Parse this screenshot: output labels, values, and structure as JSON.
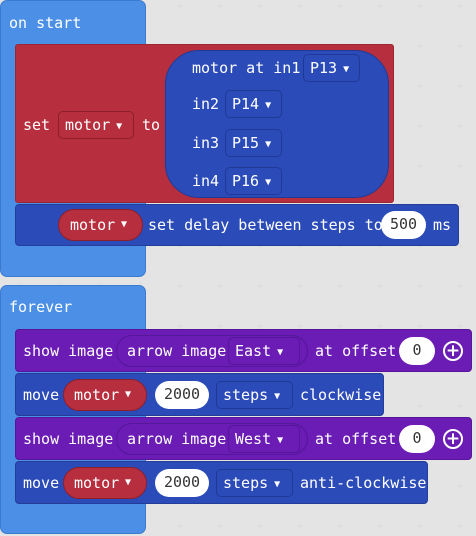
{
  "on_start": {
    "label": "on start",
    "set_block": {
      "set_label": "set",
      "variable": "motor",
      "to_label": "to",
      "motor_at": {
        "label": "motor at in1",
        "in1_pin": "P13",
        "in2_label": "in2",
        "in2_pin": "P14",
        "in3_label": "in3",
        "in3_pin": "P15",
        "in4_label": "in4",
        "in4_pin": "P16"
      }
    },
    "delay_block": {
      "variable": "motor",
      "label": "set delay between steps to",
      "value": "500",
      "unit": "ms"
    }
  },
  "forever": {
    "label": "forever",
    "show_image_1": {
      "label": "show image",
      "arrow_label": "arrow image",
      "direction": "East",
      "offset_label": "at offset",
      "offset": "0"
    },
    "move_1": {
      "label": "move",
      "variable": "motor",
      "steps": "2000",
      "unit": "steps",
      "direction": "clockwise"
    },
    "show_image_2": {
      "label": "show image",
      "arrow_label": "arrow image",
      "direction": "West",
      "offset_label": "at offset",
      "offset": "0"
    },
    "move_2": {
      "label": "move",
      "variable": "motor",
      "steps": "2000",
      "unit": "steps",
      "direction": "anti-clockwise"
    }
  },
  "icons": {
    "dropdown": "caret-down-icon",
    "expand": "plus-circle-icon"
  },
  "colors": {
    "events": "#4b8fe6",
    "variables": "#b72f3e",
    "motor": "#2b4bb8",
    "motor_dark": "#1f3a96",
    "images": "#6a1cb4",
    "images_dark": "#55169a"
  }
}
